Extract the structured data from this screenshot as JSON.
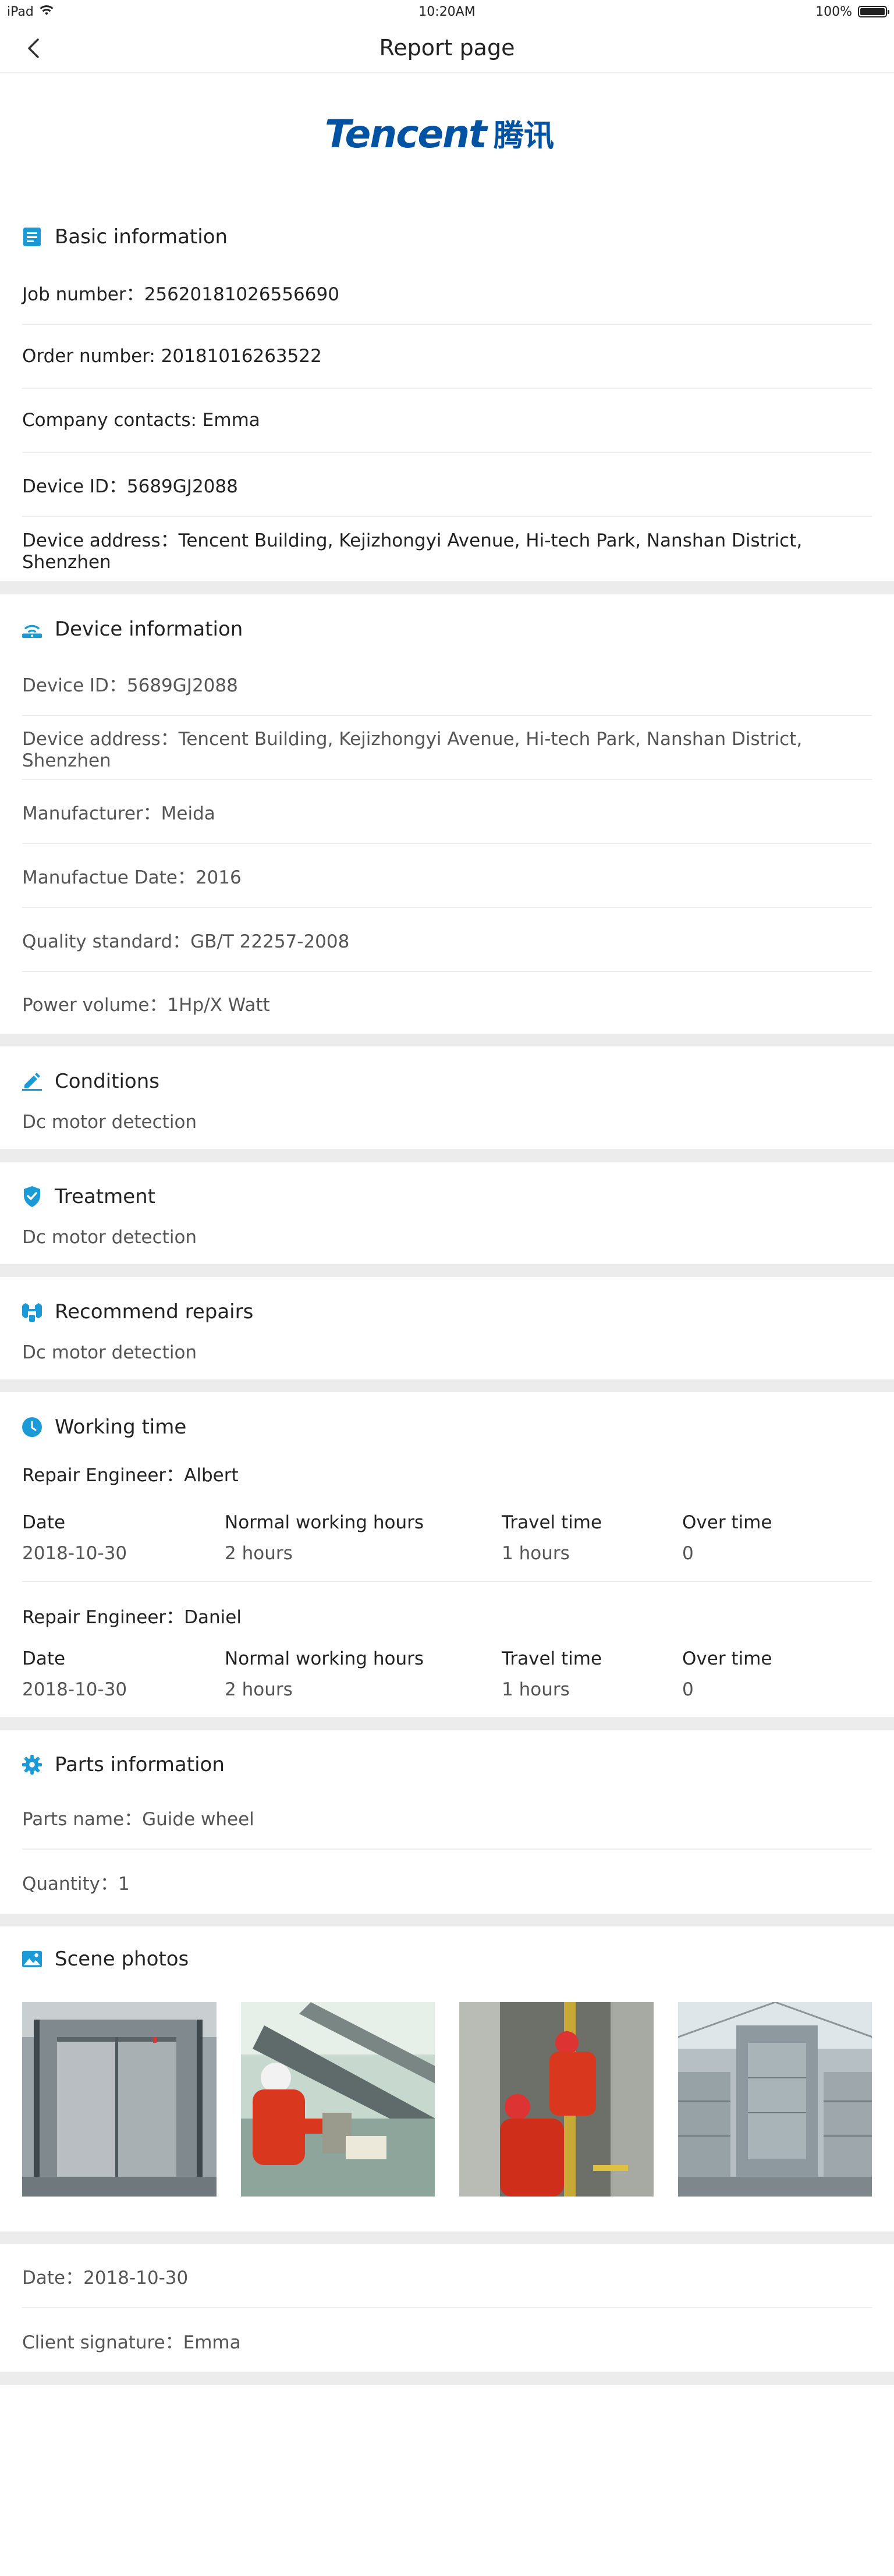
{
  "status_bar": {
    "device": "iPad",
    "time": "10:20AM",
    "battery": "100%"
  },
  "nav": {
    "title": "Report page"
  },
  "logo": {
    "text_en": "Tencent",
    "text_cn": "腾讯",
    "color": "#0052A3"
  },
  "accent_color": "#1A9AD6",
  "basic_info": {
    "title": "Basic information",
    "rows": [
      "Job number：25620181026556690",
      "Order number: 20181016263522",
      "Company contacts: Emma",
      "Device ID：5689GJ2088",
      "Device address：Tencent Building, Kejizhongyi Avenue, Hi-tech Park, Nanshan District, Shenzhen"
    ]
  },
  "device_info": {
    "title": "Device information",
    "rows": [
      "Device ID：5689GJ2088",
      "Device address：Tencent Building, Kejizhongyi Avenue, Hi-tech Park, Nanshan District, Shenzhen",
      "Manufacturer：Meida",
      "Manufactue Date：2016",
      "Quality standard：GB/T 22257-2008",
      "Power volume：1Hp/X Watt"
    ]
  },
  "conditions": {
    "title": "Conditions",
    "text": "Dc motor detection"
  },
  "treatment": {
    "title": "Treatment",
    "text": "Dc motor detection"
  },
  "recommend": {
    "title": "Recommend repairs",
    "text": "Dc motor detection"
  },
  "working_time": {
    "title": "Working time",
    "headers": [
      "Date",
      "Normal working hours",
      "Travel time",
      "Over time"
    ],
    "engineers": [
      {
        "label": "Repair Engineer：Albert",
        "values": [
          "2018-10-30",
          "2 hours",
          "1 hours",
          "0"
        ]
      },
      {
        "label": "Repair Engineer：Daniel",
        "values": [
          "2018-10-30",
          "2 hours",
          "1 hours",
          "0"
        ]
      }
    ]
  },
  "parts": {
    "title": "Parts information",
    "rows": [
      "Parts name：Guide wheel",
      "Quantity：1"
    ]
  },
  "scene_photos": {
    "title": "Scene photos",
    "photos": [
      "elevator-exterior",
      "workers-repair",
      "workers-shaft",
      "atrium-elevator"
    ]
  },
  "footer": {
    "rows": [
      "Date：2018-10-30",
      "Client signature：Emma"
    ]
  }
}
